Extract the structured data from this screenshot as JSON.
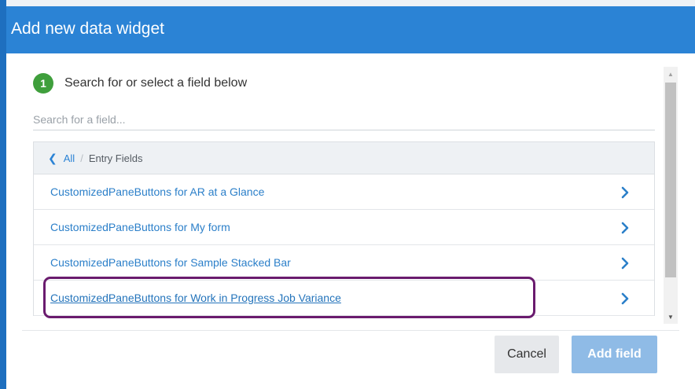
{
  "dialog": {
    "title": "Add new data widget",
    "step": {
      "number": "1",
      "text": "Search for or select a field below"
    },
    "search": {
      "placeholder": "Search for a field...",
      "value": ""
    },
    "breadcrumb": {
      "back_label": "All",
      "separator": "/",
      "current": "Entry Fields"
    },
    "fields": [
      {
        "label": "CustomizedPaneButtons for AR at a Glance"
      },
      {
        "label": "CustomizedPaneButtons for My form"
      },
      {
        "label": "CustomizedPaneButtons for Sample Stacked Bar"
      },
      {
        "label": "CustomizedPaneButtons for Work in Progress Job Variance"
      }
    ],
    "buttons": {
      "cancel": "Cancel",
      "add": "Add field"
    }
  },
  "colors": {
    "header": "#2b83d5",
    "step_badge": "#3f9f3c",
    "link": "#2b7fc9",
    "highlight_border": "#6a1b6e",
    "add_button": "#8fbbe6"
  },
  "icons": {
    "back": "chevron-left-icon",
    "row_arrow": "chevron-right-icon",
    "scroll_up": "triangle-up-icon",
    "scroll_down": "triangle-down-icon"
  }
}
